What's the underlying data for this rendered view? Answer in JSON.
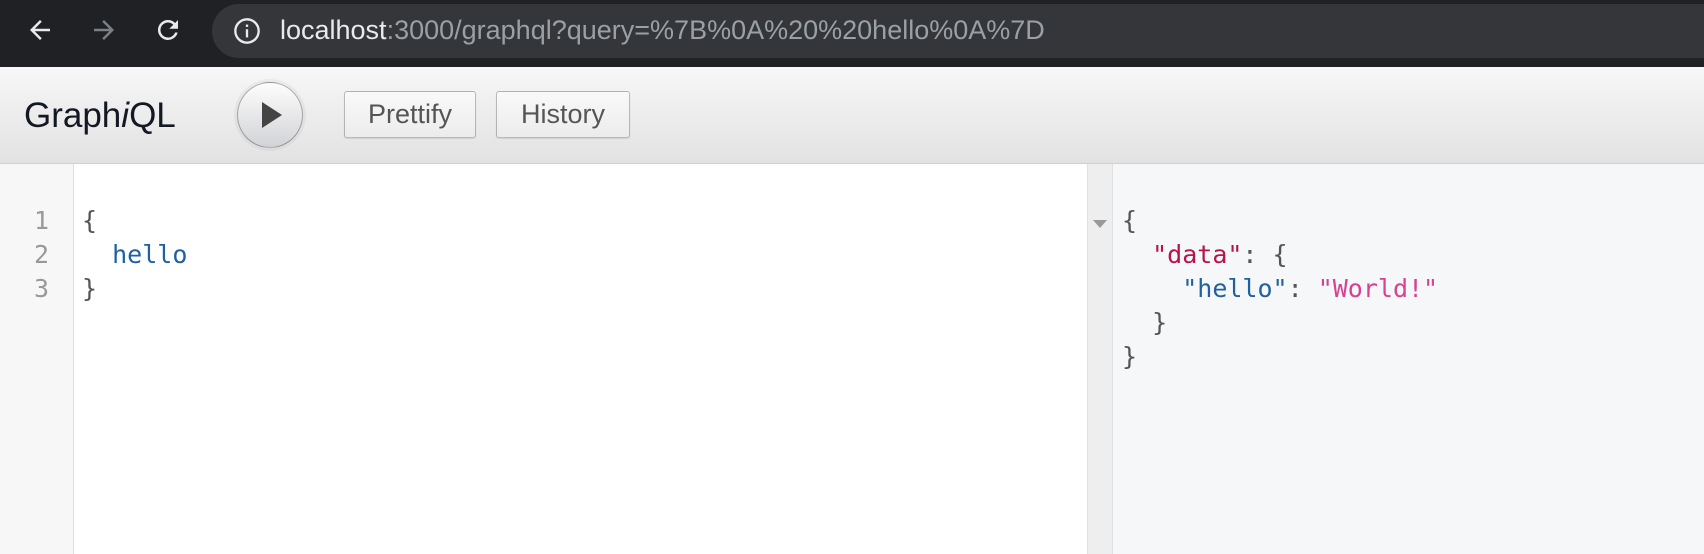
{
  "browser": {
    "url_host": "localhost",
    "url_rest": ":3000/graphql?query=%7B%0A%20%20hello%0A%7D"
  },
  "toolbar": {
    "title_prefix": "Graph",
    "title_italic": "i",
    "title_suffix": "QL",
    "prettify_label": "Prettify",
    "history_label": "History"
  },
  "query_editor": {
    "line_numbers": [
      "1",
      "2",
      "3"
    ],
    "lines": [
      {
        "text": "{"
      },
      {
        "indent": "  ",
        "field": "hello"
      },
      {
        "text": "}"
      }
    ]
  },
  "result": {
    "open_brace": "{",
    "data_key": "\"data\"",
    "data_sep": ": {",
    "hello_key": "\"hello\"",
    "hello_sep": ": ",
    "hello_value": "\"World!\"",
    "inner_close": "}",
    "outer_close": "}"
  },
  "colors": {
    "field": "#1f61a0",
    "json_key_top": "#b7134d",
    "json_string": "#d64292"
  },
  "icons": [
    "back-arrow-icon",
    "forward-arrow-icon",
    "reload-icon",
    "info-icon",
    "play-icon",
    "fold-triangle-icon"
  ]
}
